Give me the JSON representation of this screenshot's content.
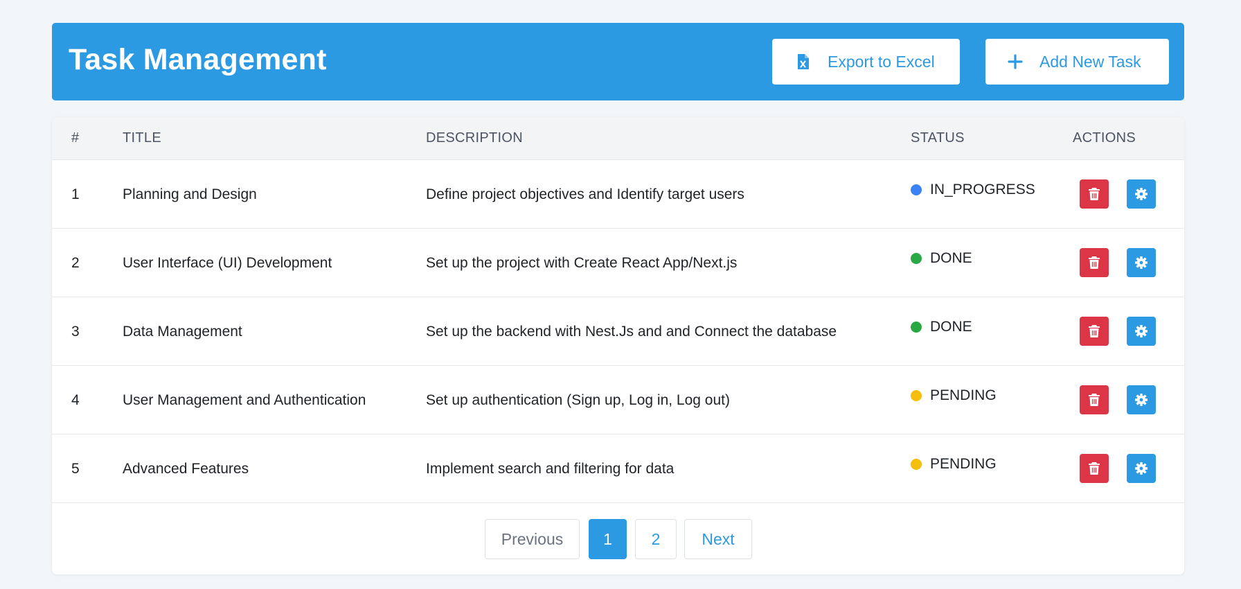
{
  "header": {
    "title": "Task Management",
    "export_label": "Export to Excel",
    "add_label": "Add New Task",
    "export_icon": "excel-file-icon",
    "add_icon": "plus-icon"
  },
  "table": {
    "columns": [
      "#",
      "TITLE",
      "DESCRIPTION",
      "STATUS",
      "ACTIONS"
    ],
    "rows": [
      {
        "num": "1",
        "title": "Planning and Design",
        "description": "Define project objectives and Identify target users",
        "status": "IN_PROGRESS",
        "status_color": "#3b82f6"
      },
      {
        "num": "2",
        "title": "User Interface (UI) Development",
        "description": "Set up the project with Create React App/Next.js",
        "status": "DONE",
        "status_color": "#2aa845"
      },
      {
        "num": "3",
        "title": "Data Management",
        "description": "Set up the backend with Nest.Js and and Connect the database",
        "status": "DONE",
        "status_color": "#2aa845"
      },
      {
        "num": "4",
        "title": "User Management and Authentication",
        "description": "Set up authentication (Sign up, Log in, Log out)",
        "status": "PENDING",
        "status_color": "#f5bd0c"
      },
      {
        "num": "5",
        "title": "Advanced Features",
        "description": "Implement search and filtering for data",
        "status": "PENDING",
        "status_color": "#f5bd0c"
      }
    ],
    "action_icons": {
      "delete": "trash-icon",
      "edit": "gear-icon"
    }
  },
  "pagination": {
    "previous_label": "Previous",
    "pages": [
      "1",
      "2"
    ],
    "current_page": "1",
    "next_label": "Next"
  },
  "colors": {
    "primary": "#2b9ae3",
    "danger": "#dc3545",
    "background": "#f3f6f9"
  }
}
